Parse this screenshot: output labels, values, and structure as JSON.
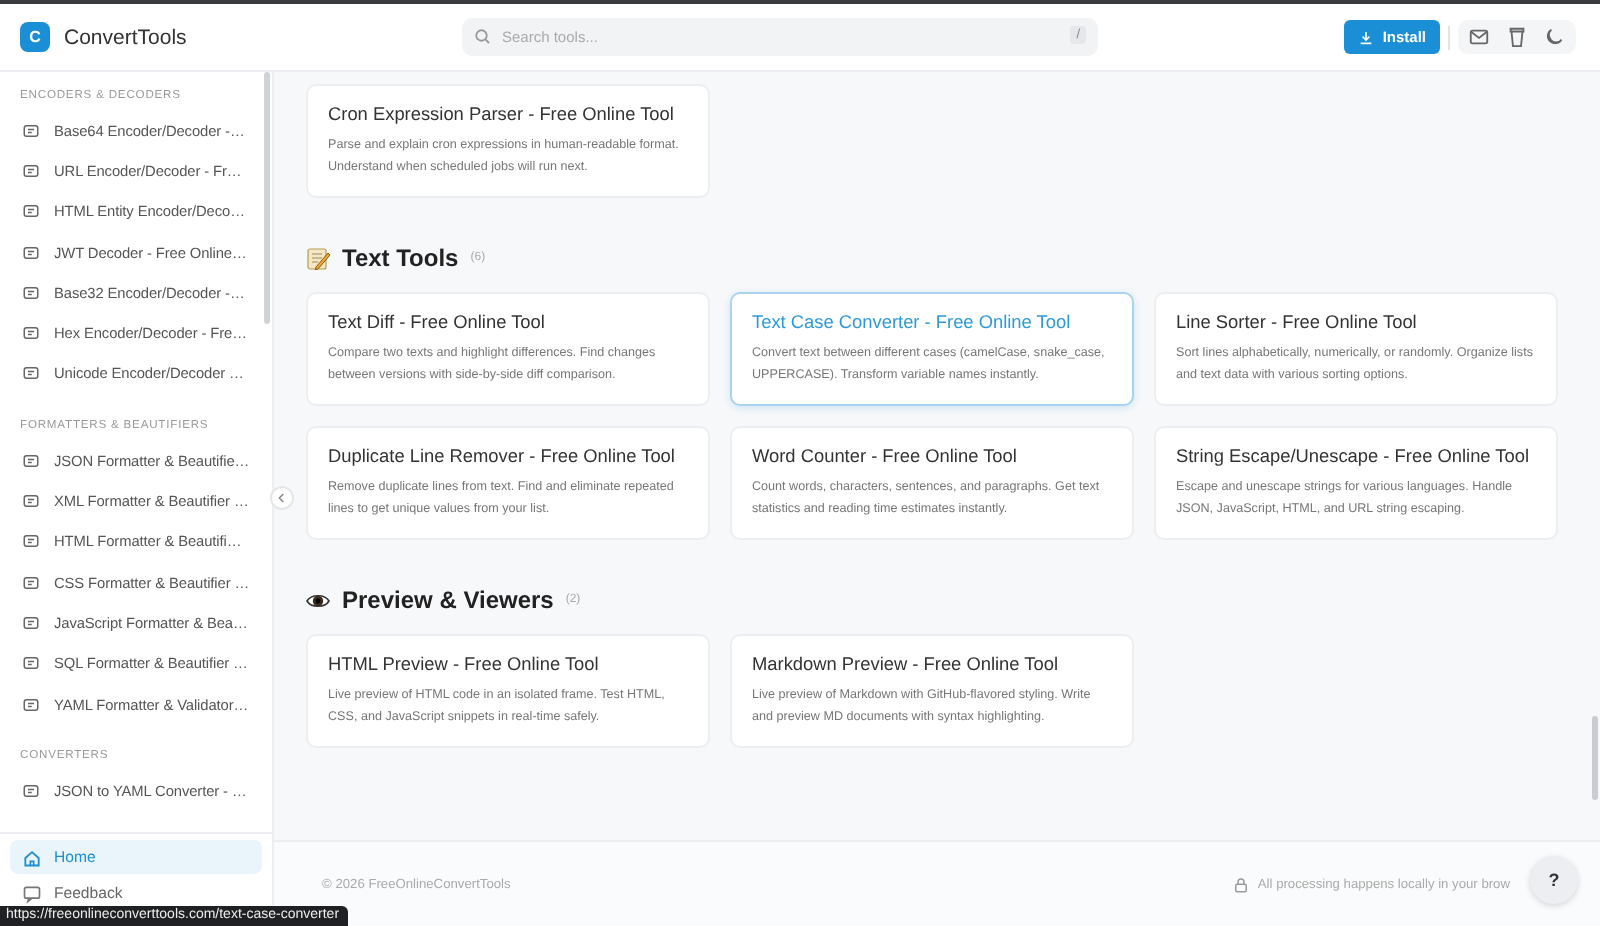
{
  "header": {
    "logo_letter": "C",
    "app_name": "ConvertTools",
    "search": {
      "placeholder": "Search tools...",
      "shortcut": "/"
    },
    "install_button": "Install"
  },
  "sidebar": {
    "groups": [
      {
        "title": "ENCODERS & DECODERS",
        "items": [
          "Base64 Encoder/Decoder -…",
          "URL Encoder/Decoder - Fr…",
          "HTML Entity Encoder/Deco…",
          "JWT Decoder - Free Online…",
          "Base32 Encoder/Decoder -…",
          "Hex Encoder/Decoder - Fre…",
          "Unicode Encoder/Decoder …"
        ]
      },
      {
        "title": "FORMATTERS & BEAUTIFIERS",
        "items": [
          "JSON Formatter & Beautifie…",
          "XML Formatter & Beautifier …",
          "HTML Formatter & Beautifi…",
          "CSS Formatter & Beautifier …",
          "JavaScript Formatter & Bea…",
          "SQL Formatter & Beautifier …",
          "YAML Formatter & Validator…"
        ]
      },
      {
        "title": "CONVERTERS",
        "items": [
          "JSON to YAML Converter - …"
        ]
      }
    ],
    "nav": [
      {
        "label": "Home",
        "kind": "home",
        "selected": true
      },
      {
        "label": "Feedback",
        "kind": "feedback",
        "selected": false
      }
    ]
  },
  "sections": [
    {
      "cards": [
        {
          "title": "Cron Expression Parser - Free Online Tool",
          "description": "Parse and explain cron expressions in human-readable format. Understand when scheduled jobs will run next.",
          "selected": false
        }
      ]
    },
    {
      "kind": "text",
      "title": "Text Tools",
      "count": "(6)",
      "cards": [
        {
          "title": "Text Diff - Free Online Tool",
          "description": "Compare two texts and highlight differences. Find changes between versions with side-by-side diff comparison.",
          "selected": false
        },
        {
          "title": "Text Case Converter - Free Online Tool",
          "description": "Convert text between different cases (camelCase, snake_case, UPPERCASE). Transform variable names instantly.",
          "selected": true
        },
        {
          "title": "Line Sorter - Free Online Tool",
          "description": "Sort lines alphabetically, numerically, or randomly. Organize lists and text data with various sorting options.",
          "selected": false
        },
        {
          "title": "Duplicate Line Remover - Free Online Tool",
          "description": "Remove duplicate lines from text. Find and eliminate repeated lines to get unique values from your list.",
          "selected": false
        },
        {
          "title": "Word Counter - Free Online Tool",
          "description": "Count words, characters, sentences, and paragraphs. Get text statistics and reading time estimates instantly.",
          "selected": false
        },
        {
          "title": "String Escape/Unescape - Free Online Tool",
          "description": "Escape and unescape strings for various languages. Handle JSON, JavaScript, HTML, and URL string escaping.",
          "selected": false
        }
      ]
    },
    {
      "kind": "preview",
      "title": "Preview & Viewers",
      "count": "(2)",
      "cards": [
        {
          "title": "HTML Preview - Free Online Tool",
          "description": "Live preview of HTML code in an isolated frame. Test HTML, CSS, and JavaScript snippets in real-time safely.",
          "selected": false
        },
        {
          "title": "Markdown Preview - Free Online Tool",
          "description": "Live preview of Markdown with GitHub-flavored styling. Write and preview MD documents with syntax highlighting.",
          "selected": false
        }
      ]
    }
  ],
  "footer": {
    "copyright": "© 2026 FreeOnlineConvertTools",
    "privacy_note": "All processing happens locally in your brow",
    "help_button": "?"
  },
  "status_url": "https://freeonlineconverttools.com/text-case-converter"
}
